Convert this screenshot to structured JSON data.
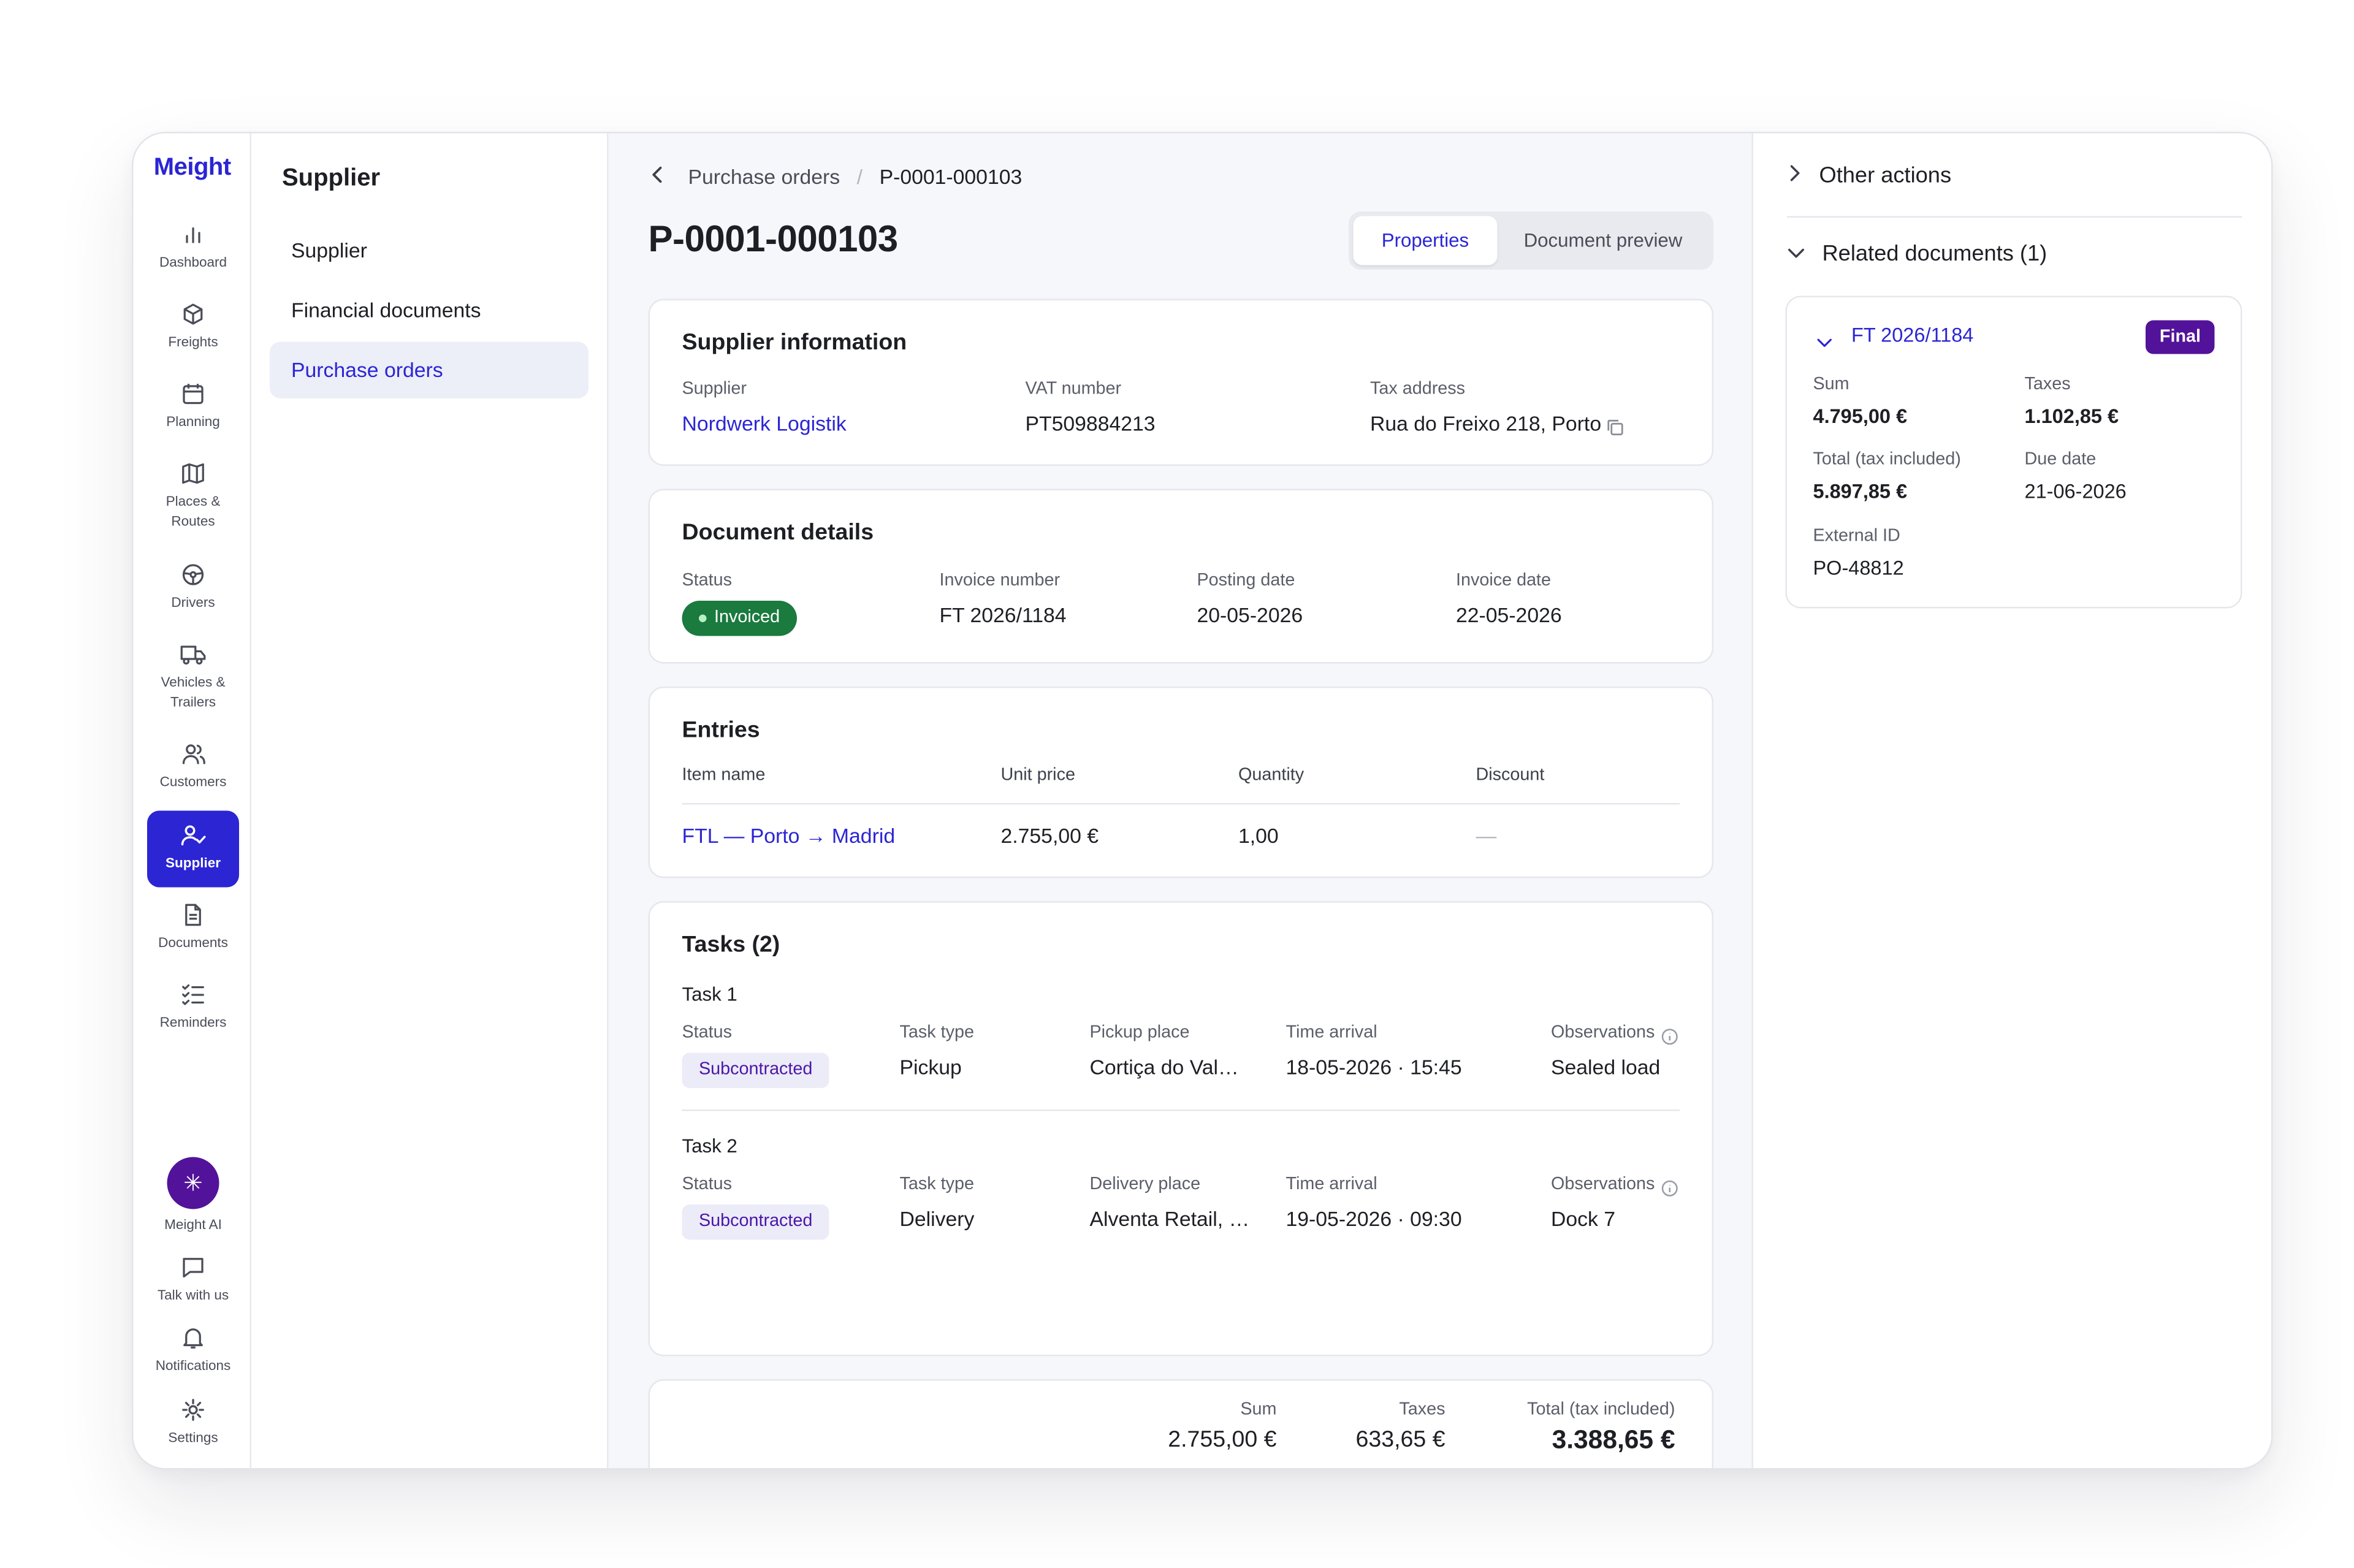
{
  "brand": "Meight",
  "nav": [
    {
      "label": "Dashboard",
      "icon": "bar-chart-icon"
    },
    {
      "label": "Freights",
      "icon": "box-icon"
    },
    {
      "label": "Planning",
      "icon": "calendar-icon"
    },
    {
      "label": "Places & Routes",
      "icon": "map-icon"
    },
    {
      "label": "Drivers",
      "icon": "steering-wheel-icon"
    },
    {
      "label": "Vehicles & Trailers",
      "icon": "truck-icon"
    },
    {
      "label": "Customers",
      "icon": "users-icon"
    },
    {
      "label": "Supplier",
      "icon": "user-check-icon",
      "active": true
    },
    {
      "label": "Documents",
      "icon": "document-icon"
    },
    {
      "label": "Reminders",
      "icon": "checklist-icon"
    }
  ],
  "nav_bottom": [
    {
      "label": "Meight AI",
      "icon": "sparkle-icon"
    },
    {
      "label": "Talk with us",
      "icon": "chat-icon"
    },
    {
      "label": "Notifications",
      "icon": "bell-icon"
    },
    {
      "label": "Settings",
      "icon": "gear-icon"
    }
  ],
  "subnav": {
    "title": "Supplier",
    "items": [
      "Supplier",
      "Financial documents",
      "Purchase orders"
    ],
    "active_index": 2
  },
  "breadcrumb": {
    "parent": "Purchase orders",
    "separator": "/",
    "current": "P-0001-000103"
  },
  "document": {
    "title": "P-0001-000103"
  },
  "view_toggle": {
    "properties": "Properties",
    "preview": "Document preview",
    "selected": "Properties"
  },
  "supplier_info": {
    "title": "Supplier information",
    "supplier_label": "Supplier",
    "supplier_value": "Nordwerk Logistik",
    "vat_label": "VAT number",
    "vat_value": "PT509884213",
    "tax_label": "Tax address",
    "tax_value": "Rua do Freixo 218, Porto"
  },
  "document_details": {
    "title": "Document details",
    "status_label": "Status",
    "status_value": "Invoiced",
    "invoice_number_label": "Invoice number",
    "invoice_number_value": "FT 2026/1184",
    "posting_date_label": "Posting date",
    "posting_date_value": "20-05-2026",
    "invoice_date_label": "Invoice date",
    "invoice_date_value": "22-05-2026"
  },
  "entries": {
    "title": "Entries",
    "headers": [
      "Item name",
      "Unit price",
      "Quantity",
      "Discount"
    ],
    "rows": [
      {
        "item": "FTL — Porto → Madrid",
        "unit_price": "2.755,00 €",
        "quantity": "1,00",
        "discount": "—"
      }
    ]
  },
  "tasks": {
    "title": "Tasks (2)",
    "items": [
      {
        "name": "Task 1",
        "status_label": "Status",
        "status": "Subcontracted",
        "type_label": "Task type",
        "type": "Pickup",
        "place_label": "Pickup place",
        "place": "Cortiça do Val…",
        "time_label": "Time arrival",
        "time": "18-05-2026 · 15:45",
        "obs_label": "Observations",
        "obs": "Sealed load"
      },
      {
        "name": "Task 2",
        "status_label": "Status",
        "status": "Subcontracted",
        "type_label": "Task type",
        "type": "Delivery",
        "place_label": "Delivery place",
        "place": "Alventa Retail, …",
        "time_label": "Time arrival",
        "time": "19-05-2026 · 09:30",
        "obs_label": "Observations",
        "obs": "Dock 7"
      }
    ]
  },
  "totals": {
    "sum_label": "Sum",
    "sum": "2.755,00 €",
    "taxes_label": "Taxes",
    "taxes": "633,65 €",
    "total_label": "Total (tax included)",
    "total": "3.388,65 €"
  },
  "right_panel": {
    "other_actions": "Other actions",
    "related_title": "Related documents (1)",
    "doc": {
      "name": "FT 2026/1184",
      "badge": "Final",
      "sum_label": "Sum",
      "sum": "4.795,00 €",
      "taxes_label": "Taxes",
      "taxes": "1.102,85 €",
      "total_label": "Total (tax included)",
      "total": "5.897,85 €",
      "due_label": "Due date",
      "due": "21-06-2026",
      "ext_label": "External ID",
      "ext": "PO-48812"
    }
  },
  "colors": {
    "accent": "#2b25d4",
    "success": "#1b7a3e",
    "purple": "#52139a",
    "badge_purple_bg": "#ecebf8"
  }
}
